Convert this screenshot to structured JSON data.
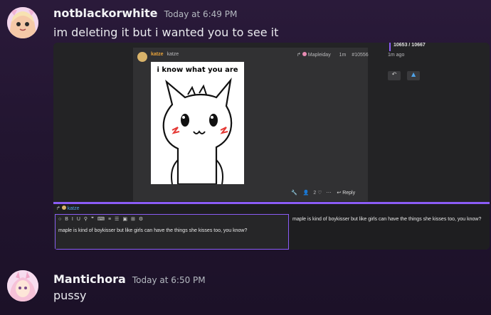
{
  "messages": [
    {
      "username": "notblackorwhite",
      "timestamp": "Today at 6:49 PM",
      "text": "im deleting it but i wanted you to see it"
    },
    {
      "username": "Mantichora",
      "timestamp": "Today at 6:50 PM",
      "text": "pussy"
    }
  ],
  "screenshot": {
    "post_author": "katze",
    "post_author_handle": "katze",
    "reply_to": "Mapleiday",
    "post_age": "1m",
    "post_number": "#10556",
    "meme_caption": "i know what you are",
    "likes": "2",
    "reply_label": "Reply",
    "side_progress": "10653 / 10667",
    "side_age": "1m ago",
    "composer_user": "katze",
    "composer_text": "maple is kind of boykisser but like girls can have the things she kisses too, you know?",
    "preview_text": "maple is kind of boykisser but like girls can have the things she kisses too, you know?"
  },
  "colors": {
    "accent_purple": "#8b5cf6",
    "author_orange": "#e8a33a",
    "blush_red": "#e53935"
  }
}
